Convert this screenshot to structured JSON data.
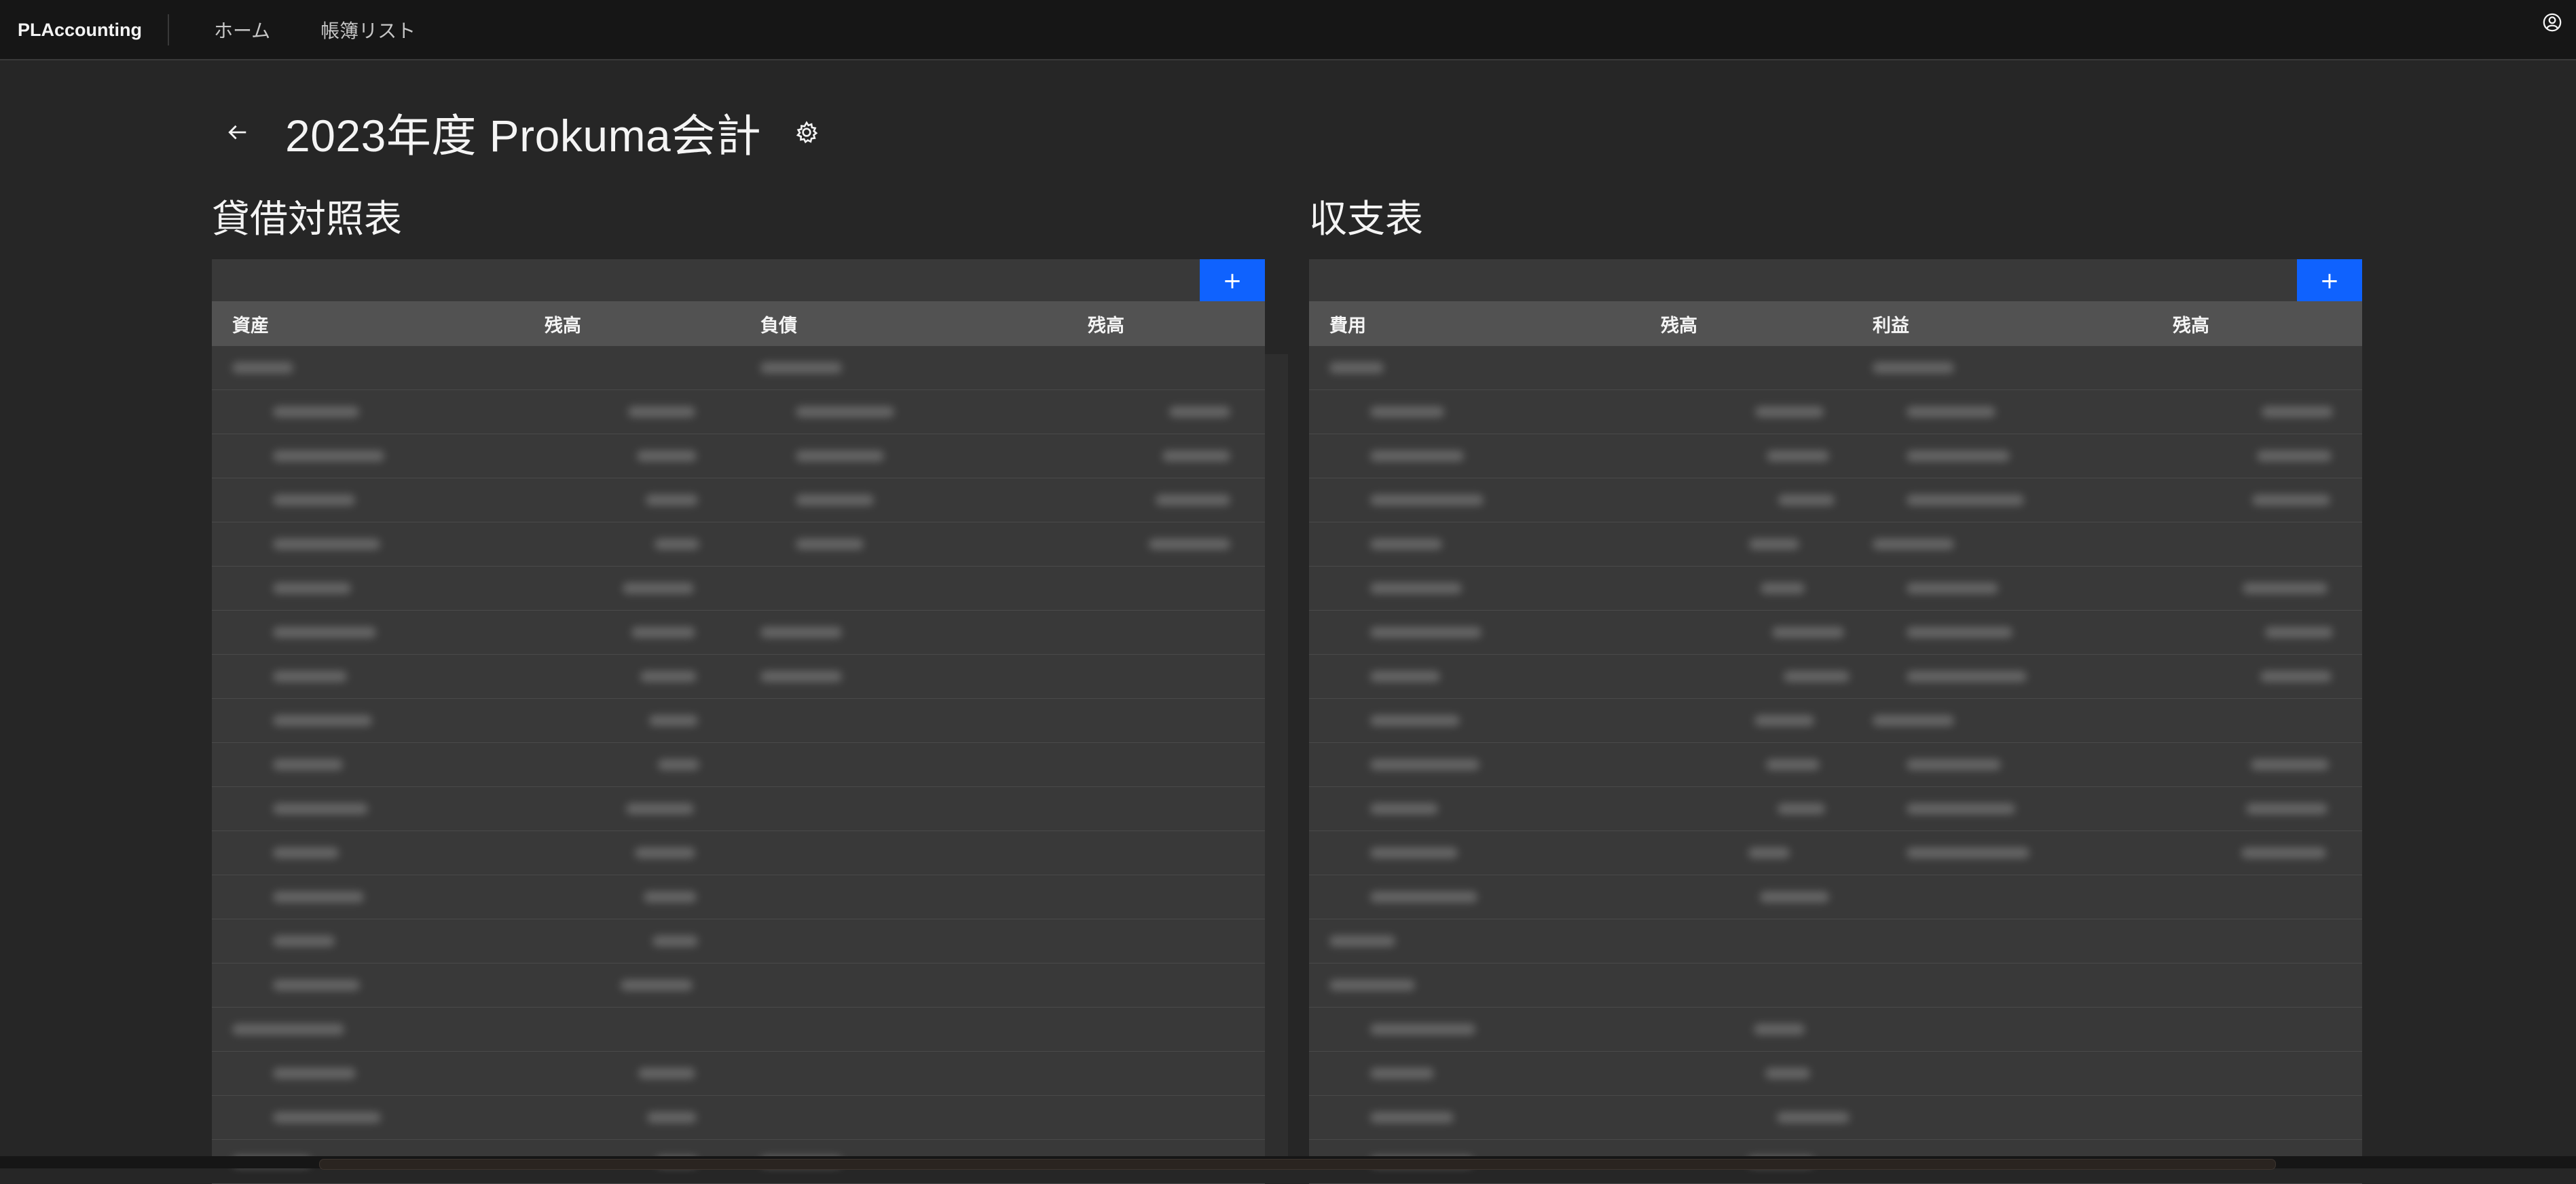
{
  "app": {
    "brand": "PLAccounting",
    "nav": [
      "ホーム",
      "帳簿リスト"
    ]
  },
  "page": {
    "title": "2023年度 Prokuma会計"
  },
  "balance_sheet": {
    "title": "貸借対照表",
    "add_label": "+",
    "columns": [
      "資産",
      "残高",
      "負債",
      "残高"
    ]
  },
  "income_statement": {
    "title": "収支表",
    "add_label": "+",
    "columns": [
      "費用",
      "残高",
      "利益",
      "残高"
    ]
  },
  "icons": {
    "user": "user-avatar-icon",
    "back": "arrow-left-icon",
    "settings": "gear-icon"
  },
  "colors": {
    "accent": "#0f62fe",
    "background": "#262626",
    "panel": "#393939",
    "header": "#525252",
    "topbar": "#161616"
  }
}
